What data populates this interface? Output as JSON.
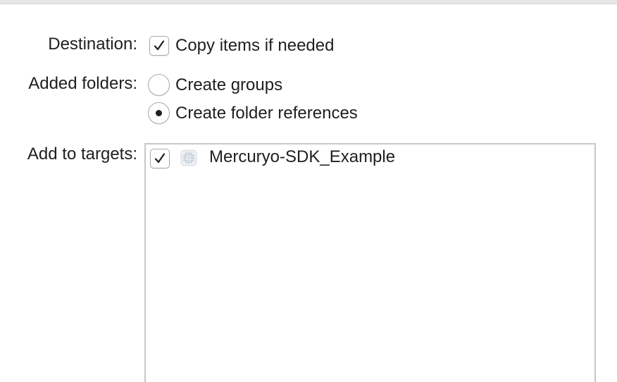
{
  "destination": {
    "label": "Destination:",
    "option_label": "Copy items if needed",
    "checked": true
  },
  "added_folders": {
    "label": "Added folders:",
    "options": [
      {
        "label": "Create groups",
        "selected": false
      },
      {
        "label": "Create folder references",
        "selected": true
      }
    ]
  },
  "add_to_targets": {
    "label": "Add to targets:",
    "targets": [
      {
        "name": "Mercuryo-SDK_Example",
        "checked": true,
        "icon": "app-target-icon"
      }
    ]
  }
}
